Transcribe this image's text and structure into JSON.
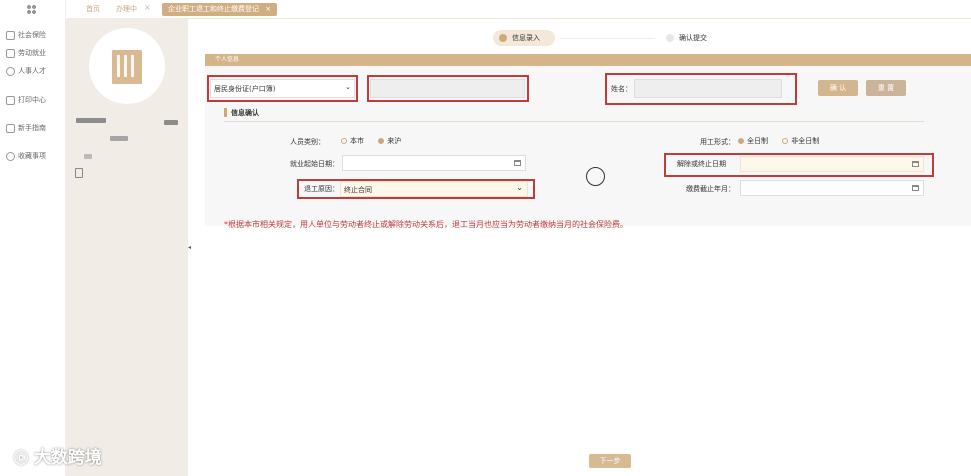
{
  "colors": {
    "gold": "#d1ae82",
    "alert": "#c23b3b",
    "panel": "#f1ede6"
  },
  "rail": {
    "items": [
      {
        "icon": "shield-icon",
        "label": "社会保险"
      },
      {
        "icon": "briefcase-icon",
        "label": "劳动就业"
      },
      {
        "icon": "user-icon",
        "label": "人事人才"
      },
      {
        "icon": "printer-icon",
        "label": "打印中心"
      },
      {
        "icon": "book-icon",
        "label": "新手指南"
      },
      {
        "icon": "star-icon",
        "label": "收藏事项"
      }
    ]
  },
  "tabs": [
    {
      "label": "首页"
    },
    {
      "label": "办理中"
    },
    {
      "label": "企业职工退工和终止缴费登记"
    }
  ],
  "steps": [
    {
      "label": "信息录入",
      "active": true
    },
    {
      "label": "确认提交",
      "active": false
    }
  ],
  "section": {
    "title": "个人信息"
  },
  "id_type": {
    "value": "居民身份证(户口簿)"
  },
  "name_label": "姓名：",
  "buttons": {
    "confirm": "确 认",
    "reset": "重 置",
    "next": "下一步"
  },
  "info_title": "信息确认",
  "person_type": {
    "label": "人员类别：",
    "options": [
      "本市",
      "来沪"
    ],
    "selected": "来沪"
  },
  "employment_form": {
    "label": "用工形式：",
    "options": [
      "全日制",
      "非全日制"
    ],
    "selected": "全日制"
  },
  "start_date": {
    "label": "就业起始日期："
  },
  "end_date": {
    "label": "解除或终止日期"
  },
  "reason": {
    "label": "退工原因：",
    "value": "终止合同"
  },
  "pay_end": {
    "label": "缴费截止年月："
  },
  "notice": "*根据本市相关规定，用人单位与劳动者终止或解除劳动关系后，退工当月也应当为劳动者缴纳当月的社会保险费。",
  "watermark": "大数跨境"
}
